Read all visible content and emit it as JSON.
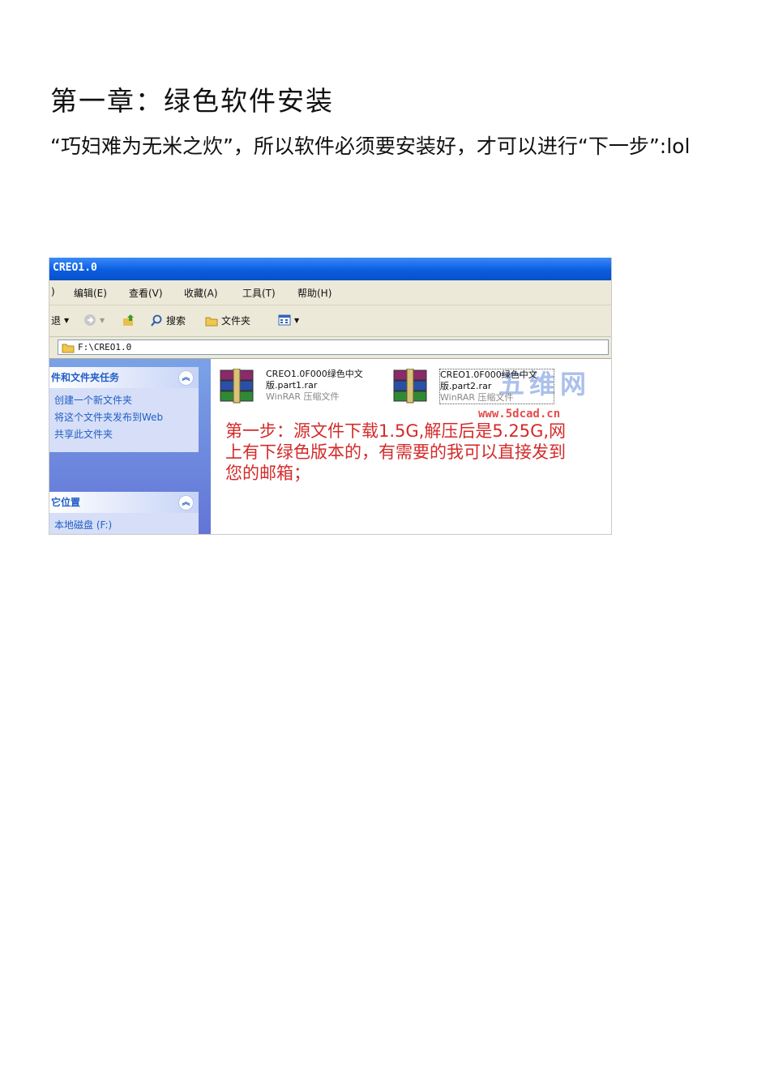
{
  "document": {
    "heading": "第一章：绿色软件安装",
    "paragraph": "“巧妇难为无米之炊”，所以软件必须要安装好，才可以进行“下一步”:lol"
  },
  "screenshot": {
    "window_title": "CREO1.0",
    "menu": [
      "编辑(E)",
      "查看(V)",
      "收藏(A)",
      "工具(T)",
      "帮助(H)"
    ],
    "menu_partial_left": ")",
    "toolbar": {
      "search_label": "搜索",
      "folders_label": "文件夹",
      "back_partial": "退"
    },
    "address": "F:\\CREO1.0",
    "side_panel": {
      "tasks_title": "件和文件夹任务",
      "tasks": [
        "创建一个新文件夹",
        "将这个文件夹发布到Web",
        "共享此文件夹"
      ],
      "places_title": "它位置",
      "places_partial": "本地磁盘 (F:)"
    },
    "files": [
      {
        "name": "CREO1.0F000绿色中文版.part1.rar",
        "type": "WinRAR 压缩文件"
      },
      {
        "name": "CREO1.0F000绿色中文版.part2.rar",
        "type": "WinRAR 压缩文件"
      }
    ],
    "watermark": "五维网",
    "watermark_url": "www.5dcad.cn",
    "annotation": "第一步：源文件下载1.5G,解压后是5.25G,网上有下绿色版本的，有需要的我可以直接发到您的邮箱；"
  }
}
